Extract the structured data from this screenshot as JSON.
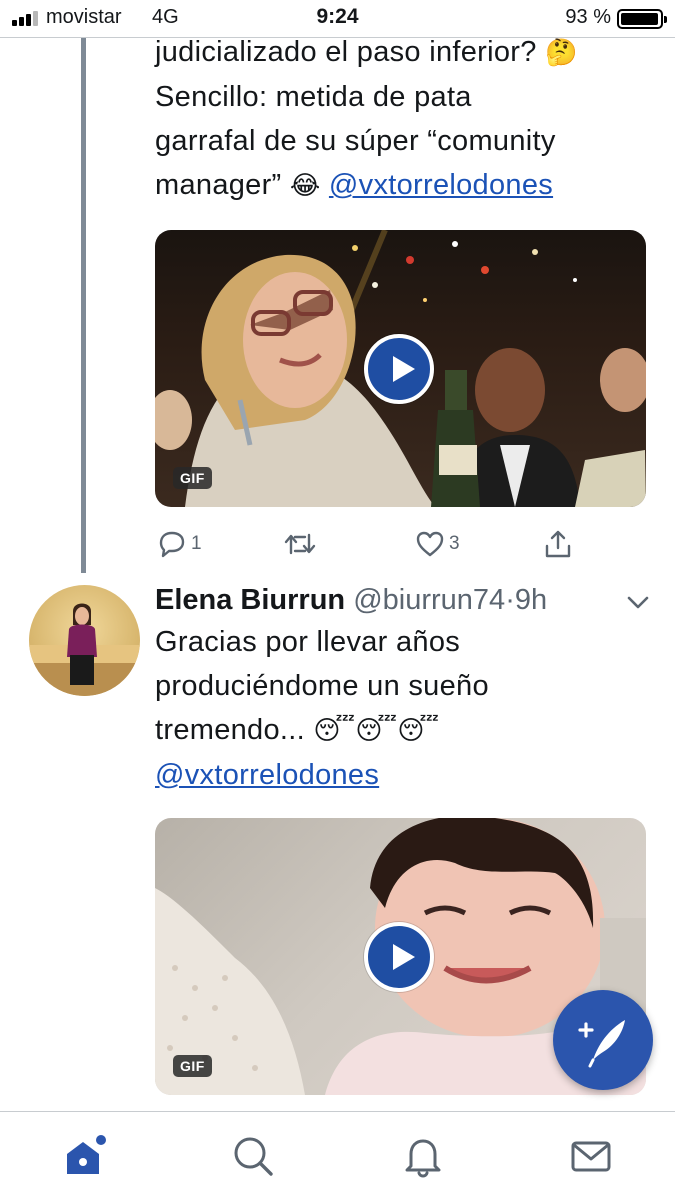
{
  "status_bar": {
    "carrier": "movistar",
    "network": "4G",
    "time": "9:24",
    "battery_text": "93 %",
    "battery_level": 0.93
  },
  "tweet1": {
    "lines": [
      "judicializado el paso inferior?",
      "Sencillo: metida de pata",
      "garrafal de su súper “comunity",
      "manager”"
    ],
    "emoji_thinking": "🤔",
    "emoji_laughing": "😂",
    "mention": "@vxtorrelodones",
    "media_badge": "GIF",
    "reply_count": "1",
    "like_count": "3"
  },
  "tweet2": {
    "display_name": "Elena Biurrun",
    "handle": "@biurrun74",
    "separator": "·",
    "time": "9h",
    "lines": [
      "Gracias por llevar años",
      "produciéndome un sueño",
      "tremendo..."
    ],
    "emoji_sleeping": "😴😴😴",
    "mention": "@vxtorrelodones",
    "media_badge": "GIF"
  },
  "icons": {
    "reply": "reply-icon",
    "retweet": "retweet-icon",
    "like": "like-icon",
    "share": "share-icon",
    "play": "play-icon",
    "chevron": "chevron-down-icon",
    "compose": "compose-icon",
    "home": "home-icon",
    "search": "search-icon",
    "notifications": "bell-icon",
    "messages": "mail-icon"
  },
  "colors": {
    "accent": "#1b52b6",
    "fab": "#2b55ad",
    "muted": "#5b6570"
  }
}
